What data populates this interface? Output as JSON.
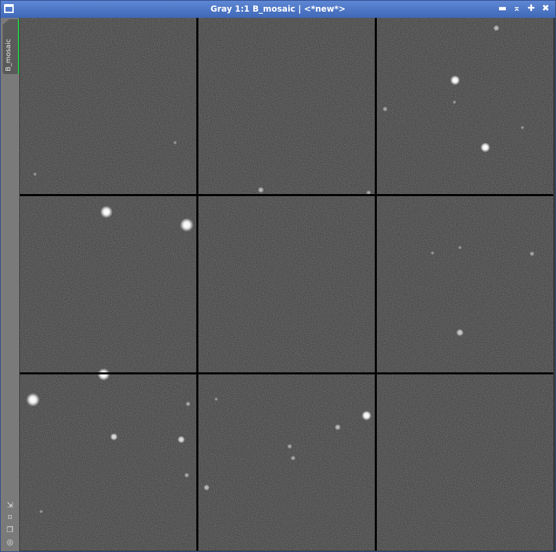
{
  "window": {
    "title": "Gray 1:1 B_mosaic | <*new*>",
    "buttons": {
      "minimize": "▬",
      "shade": "⌅",
      "maximize": "✚",
      "close": "✖"
    }
  },
  "sidebar": {
    "view_tab_label": "B_mosaic",
    "icons": [
      "arrow-diagonal-icon",
      "fit-frame-icon",
      "clone-windows-icon",
      "target-icon"
    ]
  },
  "colors": {
    "title_bar": "#4a73c4",
    "sidebar": "#7a7a7a",
    "tab_active_border": "#2fc04a",
    "tile_background": "#333333",
    "grid_lines": "#000000"
  },
  "mosaic": {
    "rows": 3,
    "cols": 3
  }
}
